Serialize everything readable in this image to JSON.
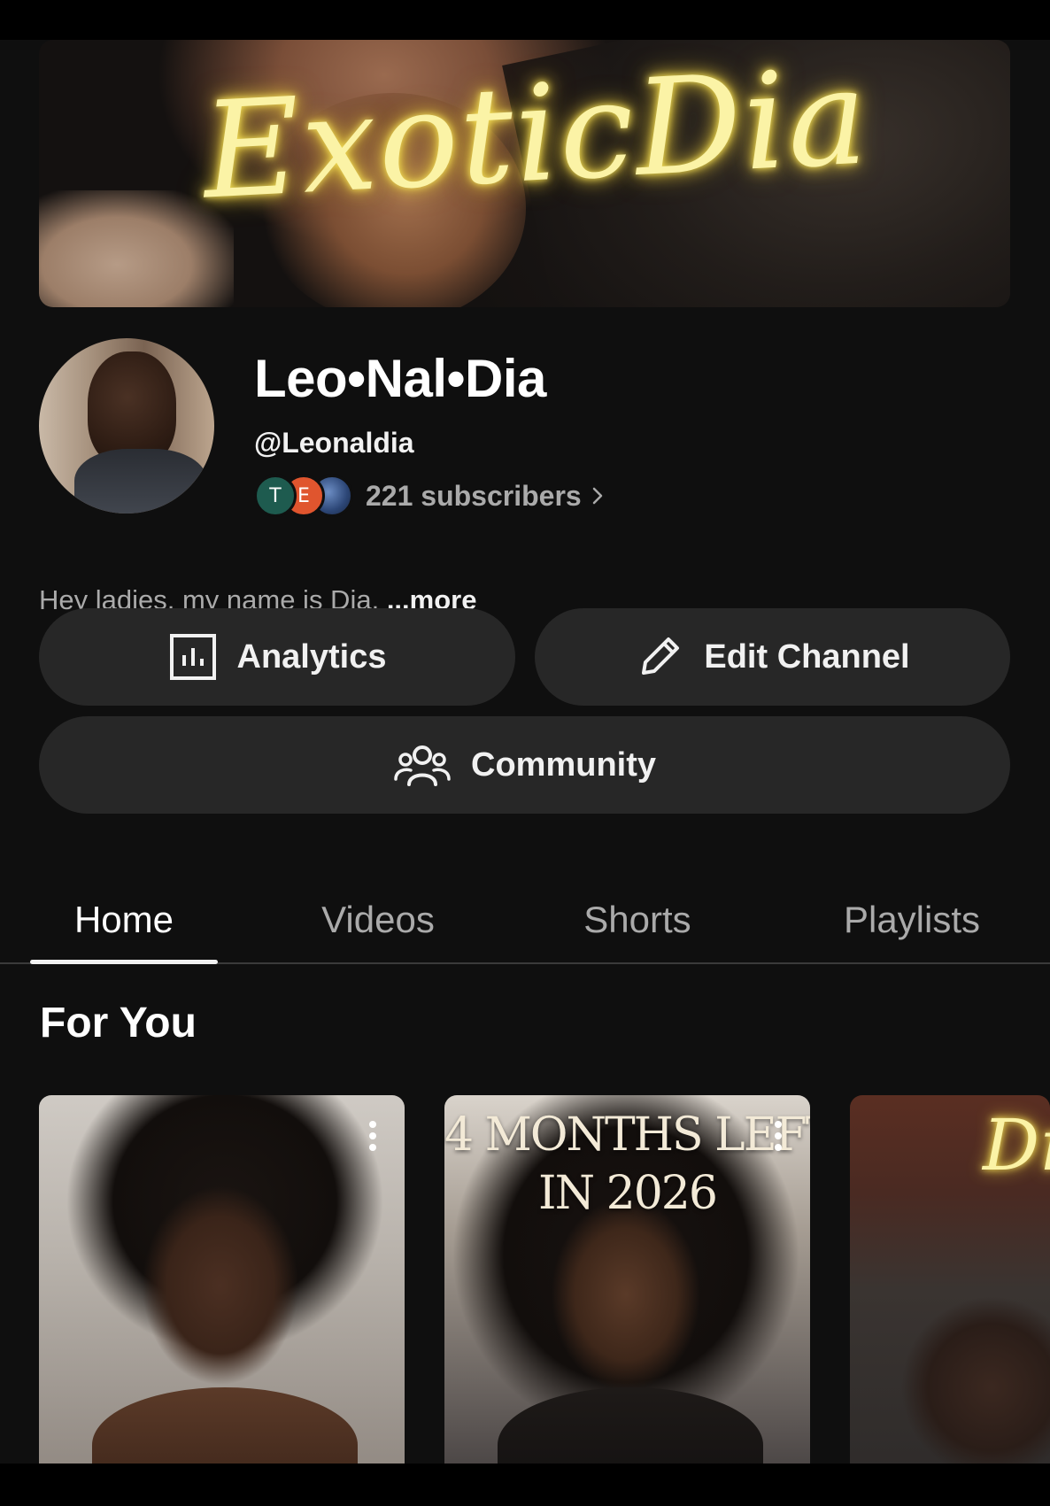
{
  "banner": {
    "title": "ExoticDia"
  },
  "channel": {
    "name": "Leo•Nal•Dia",
    "handle": "@Leonaldia",
    "subscribers": "221 subscribers",
    "subscriber_avatars": [
      "T",
      "E",
      ""
    ],
    "description": "Hey ladies, my name is Dia. ",
    "more_label": "...more"
  },
  "actions": {
    "analytics_label": "Analytics",
    "edit_label": "Edit Channel",
    "community_label": "Community"
  },
  "tabs": [
    {
      "label": "Home",
      "active": true
    },
    {
      "label": "Videos",
      "active": false
    },
    {
      "label": "Shorts",
      "active": false
    },
    {
      "label": "Playlists",
      "active": false
    }
  ],
  "section": {
    "title": "For You"
  },
  "shorts": [
    {
      "overlay_text": ""
    },
    {
      "overlay_line1": "4 MONTHS LEFT",
      "overlay_line2": "IN 2026"
    },
    {
      "overlay_text": ""
    }
  ],
  "colors": {
    "background": "#0f0f0f",
    "button_bg": "#272727",
    "secondary_text": "#aaaaaa",
    "neon": "#fbf3a6"
  }
}
